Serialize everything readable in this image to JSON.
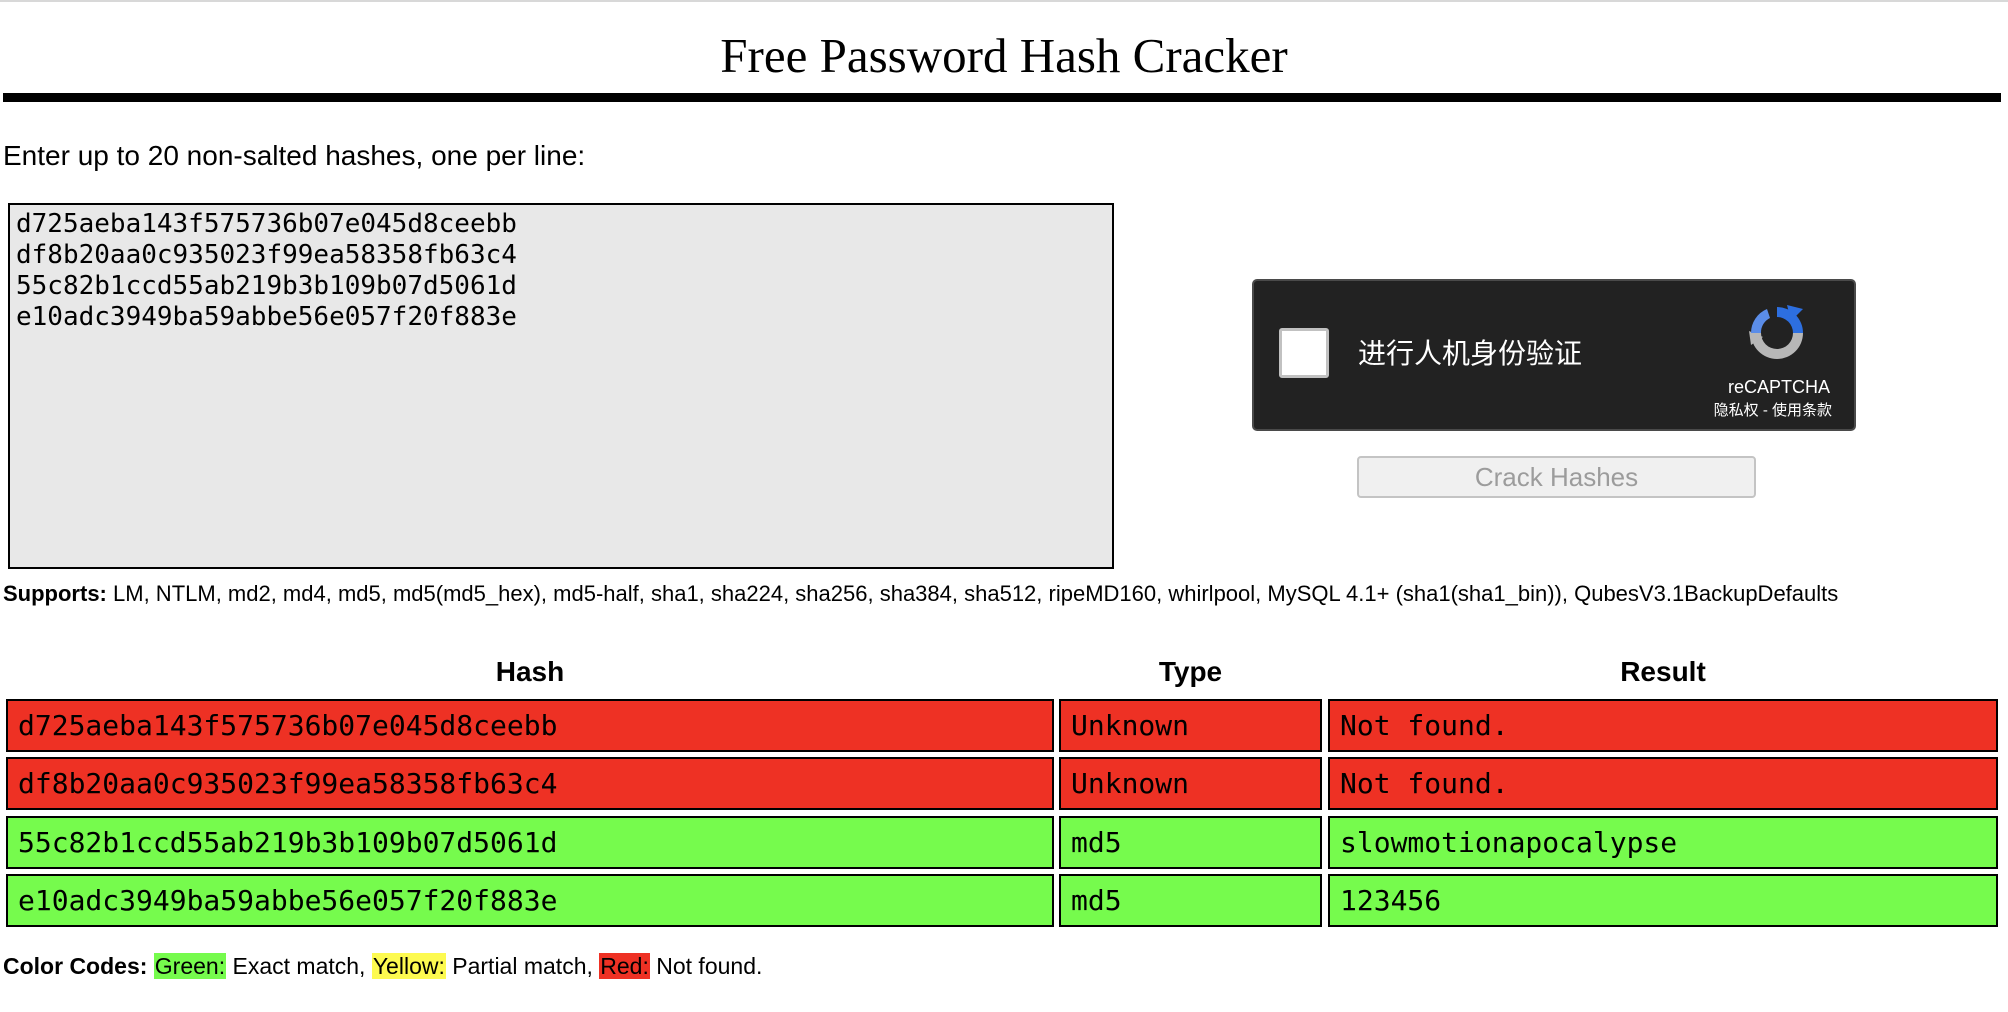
{
  "page": {
    "title": "Free Password Hash Cracker"
  },
  "instructions": "Enter up to 20 non-salted hashes, one per line:",
  "input": {
    "lines": [
      "d725aeba143f575736b07e045d8ceebb",
      "df8b20aa0c935023f99ea58358fb63c4",
      "55c82b1ccd55ab219b3b109b07d5061d",
      "e10adc3949ba59abbe56e057f20f883e"
    ]
  },
  "captcha": {
    "label": "进行人机身份验证",
    "brand": "reCAPTCHA",
    "links": "隐私权 - 使用条款",
    "icon": "recaptcha-logo"
  },
  "crack_button": {
    "label": "Crack Hashes",
    "enabled": false
  },
  "supports": {
    "label": "Supports:",
    "text": "LM, NTLM, md2, md4, md5, md5(md5_hex), md5-half, sha1, sha224, sha256, sha384, sha512, ripeMD160, whirlpool, MySQL 4.1+ (sha1(sha1_bin)), QubesV3.1BackupDefaults"
  },
  "results": {
    "headers": {
      "hash": "Hash",
      "type": "Type",
      "result": "Result"
    },
    "rows": [
      {
        "hash": "d725aeba143f575736b07e045d8ceebb",
        "type": "Unknown",
        "result": "Not found.",
        "status": "red"
      },
      {
        "hash": "df8b20aa0c935023f99ea58358fb63c4",
        "type": "Unknown",
        "result": "Not found.",
        "status": "red"
      },
      {
        "hash": "55c82b1ccd55ab219b3b109b07d5061d",
        "type": "md5",
        "result": "slowmotionapocalypse",
        "status": "green"
      },
      {
        "hash": "e10adc3949ba59abbe56e057f20f883e",
        "type": "md5",
        "result": "123456",
        "status": "green"
      }
    ]
  },
  "legend": {
    "label": "Color Codes:",
    "green": "Green:",
    "green_text": " Exact match, ",
    "yellow": "Yellow:",
    "yellow_text": " Partial match, ",
    "red": "Red:",
    "red_text": " Not found."
  },
  "colors": {
    "red": "#ee3124",
    "green": "#76fb4d",
    "yellow": "#fdfa50",
    "captcha_bg": "#222222"
  }
}
